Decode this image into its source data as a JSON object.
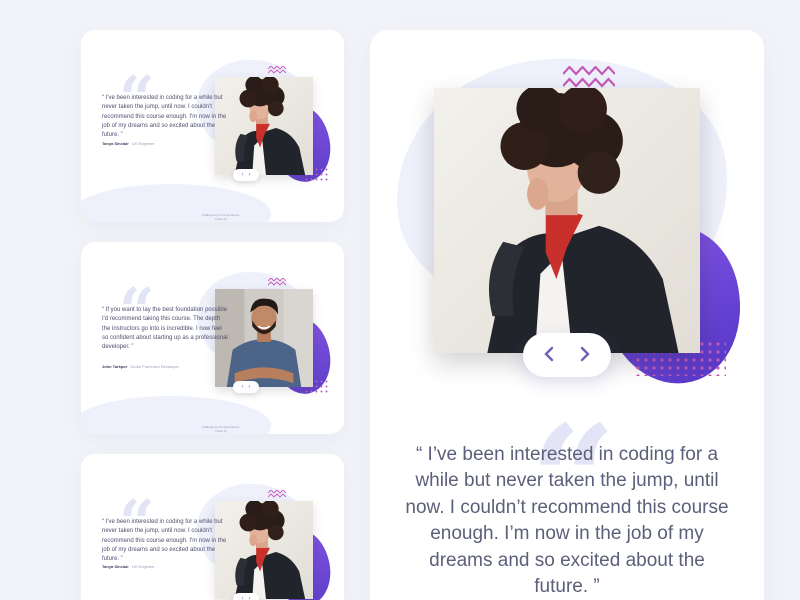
{
  "colors": {
    "background": "#f1f3f8",
    "accent_purple": "#6b46d6",
    "dots_pink": "#c65ab8",
    "link_blue": "#5a7be0"
  },
  "icons": {
    "quote": "quote-mark-icon",
    "prev": "chevron-left-icon",
    "next": "chevron-right-icon",
    "zigzag": "zigzag-icon"
  },
  "cards": [
    {
      "quote_text": "“ I've been interested in coding for a while but never taken the jump, until now. I couldn't recommend this course enough. I'm now in the job of my dreams and so excited about the future. ”",
      "author_name": "Tanya Sinclair",
      "author_role": "UX Engineer",
      "footer_line1": "Challenge by Frontend Mentor.",
      "footer_line2": "Coded by"
    },
    {
      "quote_text": "“ If you want to lay the best foundation possible I'd recommend taking this course. The depth the instructors go into is incredible. I now feel so confident about starting up as a professional developer. ”",
      "author_name": "John Tarkpor",
      "author_role": "Junior Front-end Developer",
      "footer_line1": "Challenge by Frontend Mentor.",
      "footer_line2": "Coded by"
    },
    {
      "quote_text": "“ I've been interested in coding for a while but never taken the jump, until now. I couldn't recommend this course enough. I'm now in the job of my dreams and so excited about the future. ”",
      "author_name": "Tanya Sinclair",
      "author_role": "UX Engineer"
    }
  ],
  "main": {
    "quote_text": "“ I’ve been interested in coding for a while but never taken the jump, until now. I couldn’t recommend this course enough. I’m now in the job of my dreams and so excited about the future. ”",
    "prev_label": "‹",
    "next_label": "›"
  }
}
